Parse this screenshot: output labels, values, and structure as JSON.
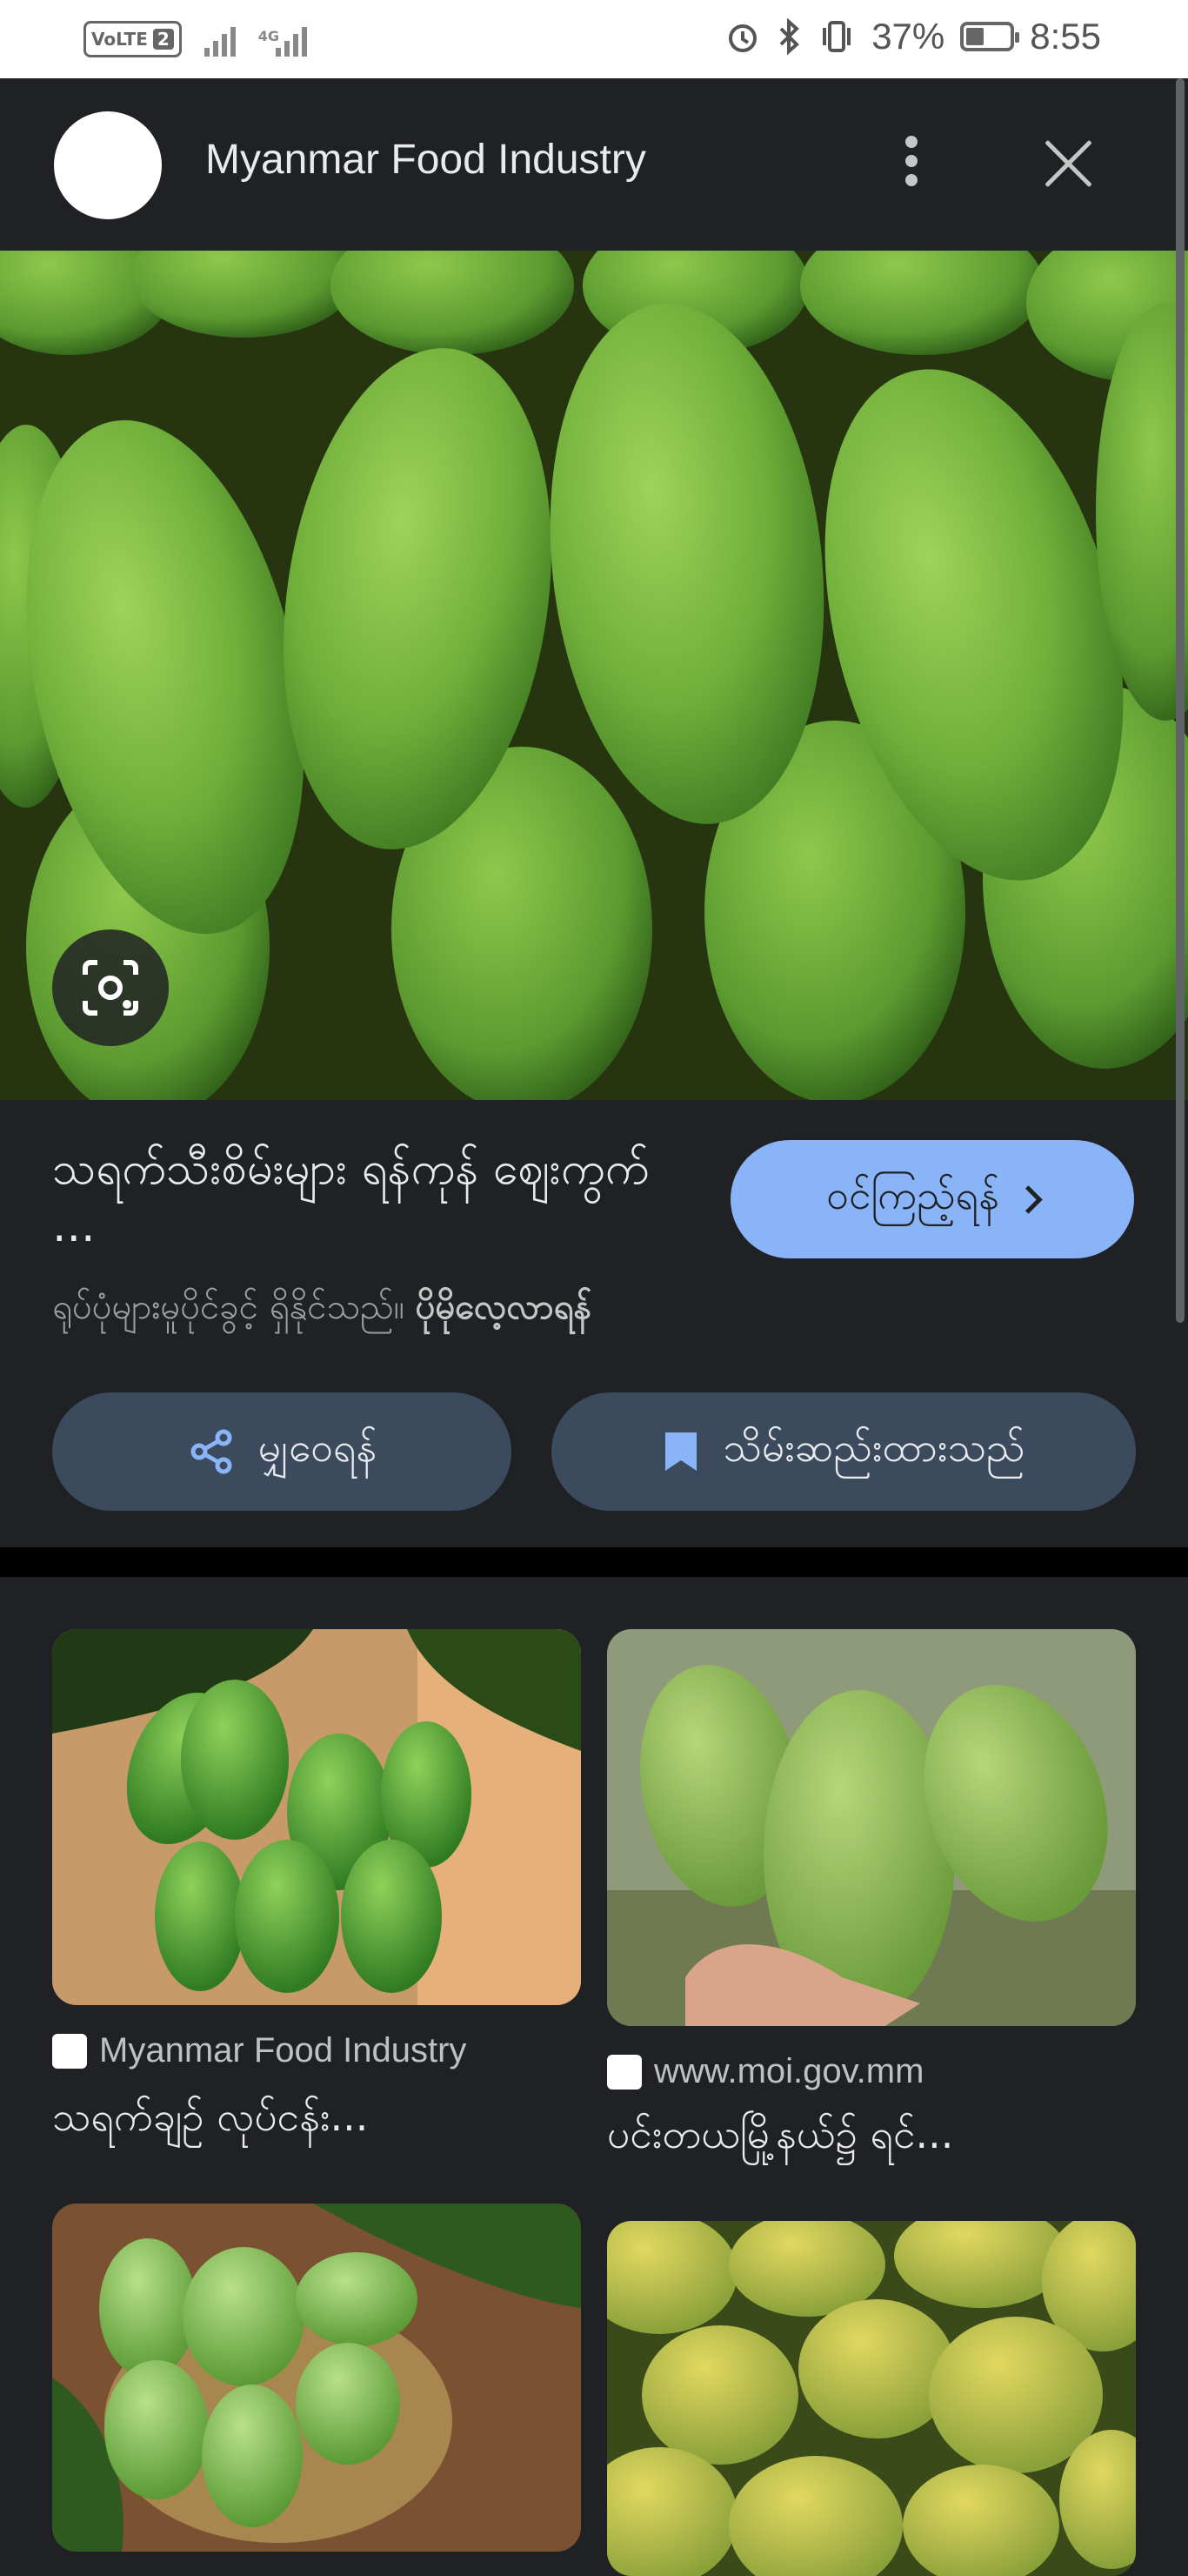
{
  "status_bar": {
    "volte": "VoLTE",
    "sim": "2",
    "network": "4G",
    "battery": "37%",
    "time": "8:55",
    "battery_level": 0.37
  },
  "header": {
    "title": "Myanmar Food Industry"
  },
  "result": {
    "title": "သရက်သီးစိမ်းများ ရန်ကုန် ဈေးကွက် ...",
    "visit_label": "ဝင်ကြည့်ရန်",
    "subtitle": "ရုပ်ပုံများမူပိုင်ခွင့် ရှိနိုင်သည်။",
    "learn_more": "ပိုမိုလေ့လာရန်",
    "share_label": "မျှဝေရန်",
    "save_label": "သိမ်းဆည်းထားသည်"
  },
  "related": [
    {
      "source": "Myanmar Food Industry",
      "caption": "သရက်ချဉ် လုပ်ငန်း..."
    },
    {
      "source": "www.moi.gov.mm",
      "caption": "ပင်းတယမြို့နယ်၌ ရင်..."
    }
  ],
  "colors": {
    "background": "#202124",
    "accent": "#8ab4f8",
    "chip": "#3c4a5e"
  }
}
